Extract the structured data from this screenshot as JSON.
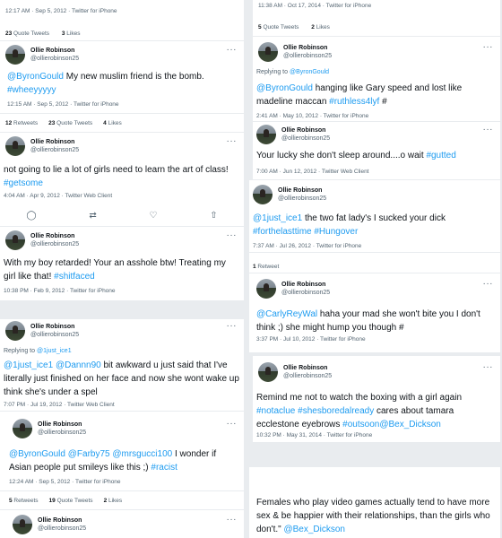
{
  "user": {
    "name": "Ollie Robinson",
    "handle": "@ollierobinson25"
  },
  "icons": [
    "reply-icon",
    "retweet-icon",
    "like-icon",
    "share-icon",
    "more-icon"
  ],
  "colors": {
    "link": "#1d9bf0",
    "muted": "#536471",
    "text": "#0f1419",
    "background": "#e9ecef"
  },
  "left": {
    "top_fragment": {
      "meta": "12:17 AM · Sep 5, 2012 · Twitter for iPhone",
      "stats": [
        {
          "count": "23",
          "label": "Quote Tweets"
        },
        {
          "count": "3",
          "label": "Likes"
        }
      ]
    },
    "tweets": [
      {
        "parts": [
          {
            "t": "@ByronGould",
            "link": true
          },
          {
            "t": "  My new muslim friend is the bomb. "
          },
          {
            "t": "#wheeyyyyy",
            "link": true
          }
        ],
        "meta": "12:15 AM · Sep 5, 2012 · Twitter for iPhone",
        "stats": [
          {
            "count": "12",
            "label": "Retweets"
          },
          {
            "count": "23",
            "label": "Quote Tweets"
          },
          {
            "count": "4",
            "label": "Likes"
          }
        ]
      },
      {
        "parts": [
          {
            "t": "not going to lie a lot of girls need to learn the art of class! "
          },
          {
            "t": "#getsome",
            "link": true
          }
        ],
        "meta": "4:04 AM · Apr 9, 2012 · Twitter Web Client"
      },
      {
        "parts": [
          {
            "t": "With my boy retarded! Your an asshole btw! Treating my girl like that! "
          },
          {
            "t": "#shitfaced",
            "link": true
          }
        ],
        "meta": "10:38 PM · Feb 9, 2012 · Twitter for iPhone"
      },
      {
        "reply_prefix": "Replying to ",
        "reply_to": "@1just_ice1",
        "parts": [
          {
            "t": "@1just_ice1",
            "link": true
          },
          {
            "t": " "
          },
          {
            "t": "@Dannn90",
            "link": true
          },
          {
            "t": " bit awkward u just said that I've literally just finished on her face and now she wont wake up think she's under a spel"
          }
        ],
        "meta": "7:07 PM · Jul 19, 2012 · Twitter Web Client"
      },
      {
        "parts": [
          {
            "t": "@ByronGould",
            "link": true
          },
          {
            "t": " "
          },
          {
            "t": "@Farby75",
            "link": true
          },
          {
            "t": " "
          },
          {
            "t": "@mrsgucci100",
            "link": true
          },
          {
            "t": "  I wonder if Asian people put smileys like this ;) "
          },
          {
            "t": "#racist",
            "link": true
          }
        ],
        "meta": "12:24 AM · Sep 5, 2012 · Twitter for iPhone",
        "stats": [
          {
            "count": "5",
            "label": "Retweets"
          },
          {
            "count": "19",
            "label": "Quote Tweets"
          },
          {
            "count": "2",
            "label": "Likes"
          }
        ]
      }
    ]
  },
  "right": {
    "top_fragment": {
      "meta": "11:38 AM · Oct 17, 2014 · Twitter for iPhone",
      "stats": [
        {
          "count": "5",
          "label": "Quote Tweets"
        },
        {
          "count": "2",
          "label": "Likes"
        }
      ]
    },
    "tweets": [
      {
        "reply_prefix": "Replying to ",
        "reply_to": "@ByronGould",
        "parts": [
          {
            "t": "@ByronGould",
            "link": true
          },
          {
            "t": " hanging like Gary speed and lost like madeline maccan "
          },
          {
            "t": "#ruthless4lyf",
            "link": true
          },
          {
            "t": " #"
          }
        ],
        "meta": "2:41 AM · May 10, 2012 · Twitter for iPhone"
      },
      {
        "parts": [
          {
            "t": "Your lucky she don't sleep around....o wait "
          },
          {
            "t": "#gutted",
            "link": true
          }
        ],
        "meta": "7:00 AM · Jun 12, 2012 · Twitter Web Client"
      },
      {
        "parts": [
          {
            "t": "@1just_ice1",
            "link": true
          },
          {
            "t": " the two fat lady's I sucked your dick "
          },
          {
            "t": "#forthelasttime",
            "link": true
          },
          {
            "t": " "
          },
          {
            "t": "#Hungover",
            "link": true
          }
        ],
        "meta": "7:37 AM · Jul 26, 2012 · Twitter for iPhone",
        "stats": [
          {
            "count": "1",
            "label": "Retweet"
          }
        ]
      },
      {
        "parts": [
          {
            "t": "@CarlyReyWal",
            "link": true
          },
          {
            "t": " haha your mad she won't bite you I don't think ;) she might hump you though #"
          }
        ],
        "meta": "3:37 PM · Jul 10, 2012 · Twitter for iPhone"
      },
      {
        "parts": [
          {
            "t": "Remind me not to watch the boxing with a girl again "
          },
          {
            "t": "#notaclue",
            "link": true
          },
          {
            "t": " "
          },
          {
            "t": "#shesboredalready",
            "link": true
          },
          {
            "t": " cares about tamara ecclestone eyebrows "
          },
          {
            "t": "#outsoon",
            "link": true
          },
          {
            "t": "@Bex_Dickson",
            "link": true
          }
        ],
        "meta": "10:32 PM · May 31, 2014 · Twitter for iPhone"
      },
      {
        "parts": [
          {
            "t": "Females who play video games actually tend to have more sex & be happier with their relationships, than the girls who don't.\" "
          },
          {
            "t": "@Bex_Dickson",
            "link": true
          }
        ]
      }
    ]
  }
}
